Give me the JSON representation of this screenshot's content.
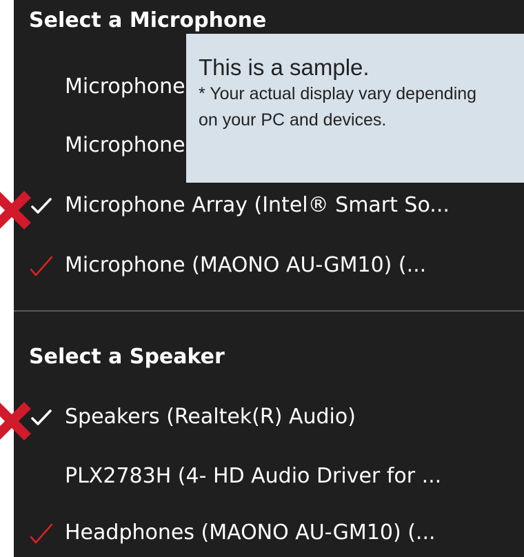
{
  "microphone_section": {
    "title": "Select a Microphone",
    "items": [
      {
        "label": "Microphone"
      },
      {
        "label": "Microphone"
      },
      {
        "label": "Microphone Array (Intel® Smart So..."
      },
      {
        "label": "Microphone (MAONO AU-GM10) (..."
      }
    ]
  },
  "speaker_section": {
    "title": "Select a Speaker",
    "items": [
      {
        "label": "Speakers (Realtek(R) Audio)"
      },
      {
        "label": "PLX2783H (4- HD Audio Driver for ..."
      },
      {
        "label": "Headphones (MAONO AU-GM10) (..."
      }
    ]
  },
  "sample_note": {
    "title": "This is a sample.",
    "body": "* Your actual display vary depending on your PC and devices."
  },
  "colors": {
    "menu_background": "#1f1f1f",
    "text": "#ffffff",
    "check_white": "#ffffff",
    "check_red": "#e02020",
    "red_x": "#d11a2a",
    "note_background": "#d7e1ea"
  },
  "icons": {
    "selected_check": "check-icon",
    "wrong_mark": "red-x-icon",
    "correct_mark": "red-check-icon"
  }
}
